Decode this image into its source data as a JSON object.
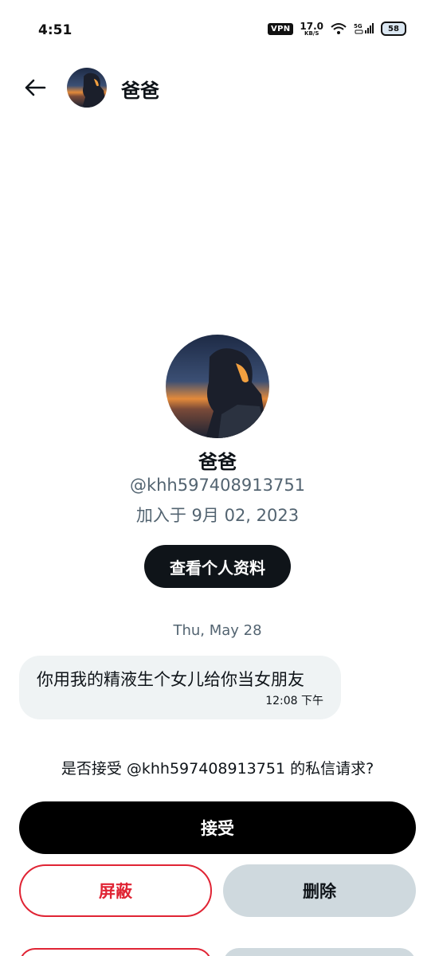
{
  "status_bar": {
    "time": "4:51",
    "vpn": "VPN",
    "net_speed_value": "17.0",
    "net_speed_unit": "KB/S",
    "signal": "5G",
    "battery": "58"
  },
  "header": {
    "title": "爸爸",
    "back_icon": "back-arrow-icon"
  },
  "profile": {
    "name": "爸爸",
    "handle": "@khh597408913751",
    "joined": "加入于 9月 02, 2023",
    "view_profile_label": "查看个人资料"
  },
  "conversation": {
    "date": "Thu, May 28",
    "messages": [
      {
        "text": "你用我的精液生个女儿给你当女朋友",
        "time": "12:08 下午"
      }
    ]
  },
  "request": {
    "prompt": "是否接受 @khh597408913751 的私信请求?",
    "accept_label": "接受",
    "block_label": "屏蔽",
    "delete_label": "删除"
  },
  "colors": {
    "accent_red": "#e02434",
    "text_primary": "#0f1419",
    "text_secondary": "#536471",
    "bubble_bg": "#eff3f4",
    "delete_bg": "#cfd9de"
  }
}
